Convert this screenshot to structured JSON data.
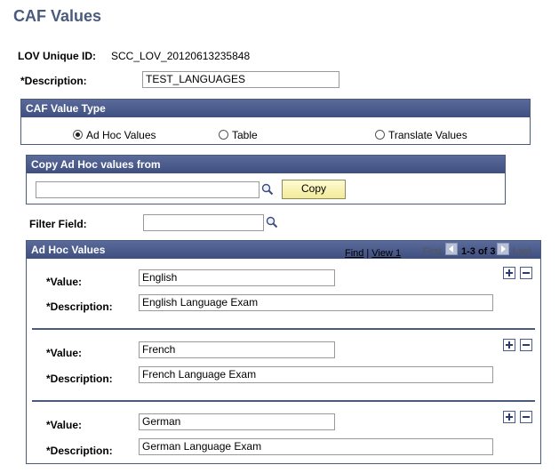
{
  "page": {
    "title": "CAF Values"
  },
  "lov": {
    "label": "LOV Unique ID:",
    "value": "SCC_LOV_20120613235848"
  },
  "description": {
    "label": "*Description:",
    "value": "TEST_LANGUAGES"
  },
  "value_type": {
    "header": "CAF Value Type",
    "options": [
      {
        "label": "Ad Hoc Values",
        "selected": true
      },
      {
        "label": "Table",
        "selected": false
      },
      {
        "label": "Translate Values",
        "selected": false
      }
    ]
  },
  "copy": {
    "header": "Copy Ad Hoc values from",
    "input_value": "",
    "button_label": "Copy"
  },
  "filter": {
    "label": "Filter Field:",
    "value": ""
  },
  "adhoc": {
    "header": "Ad Hoc Values",
    "find_label": "Find",
    "separator": "|",
    "view_label": "View 1",
    "first_label": "First",
    "range_label": "1-3 of 3",
    "last_label": "Last",
    "value_label": "*Value:",
    "desc_label": "*Description:",
    "rows": [
      {
        "value": "English",
        "description": "English Language Exam"
      },
      {
        "value": "French",
        "description": "French Language Exam"
      },
      {
        "value": "German",
        "description": "German Language Exam"
      }
    ]
  },
  "icons": {
    "lookup": "magnifier-icon",
    "add": "plus-icon",
    "delete": "minus-icon",
    "prev": "arrow-left-icon",
    "next": "arrow-right-icon"
  },
  "colors": {
    "header_bg": "#4b5b8e",
    "title": "#4b5b7e",
    "button_bg": "#fbf6b8"
  }
}
